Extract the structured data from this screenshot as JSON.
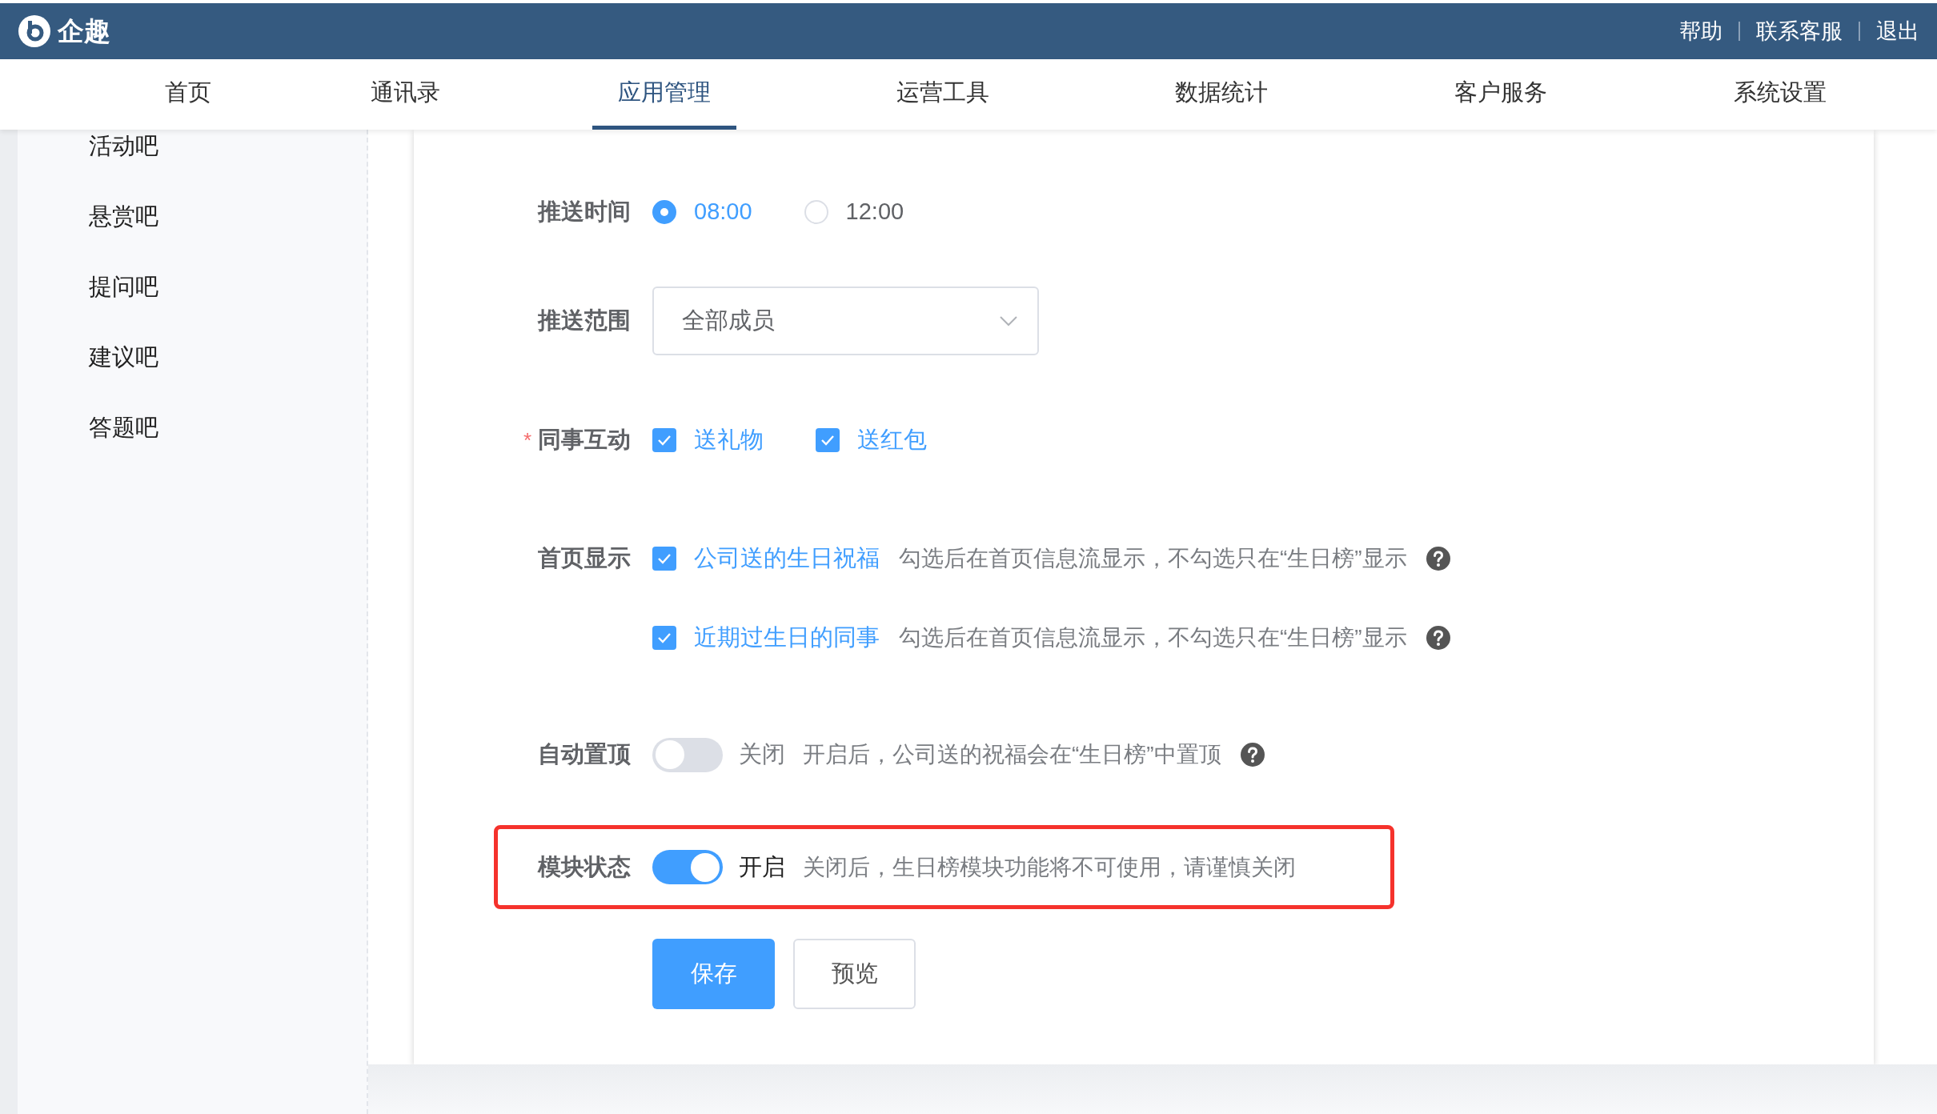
{
  "header": {
    "logo_text": "企趣",
    "links": [
      "帮助",
      "联系客服",
      "退出"
    ]
  },
  "nav": [
    {
      "label": "首页",
      "selected": false
    },
    {
      "label": "通讯录",
      "selected": false
    },
    {
      "label": "应用管理",
      "selected": true
    },
    {
      "label": "运营工具",
      "selected": false
    },
    {
      "label": "数据统计",
      "selected": false
    },
    {
      "label": "客户服务",
      "selected": false
    },
    {
      "label": "系统设置",
      "selected": false
    }
  ],
  "sidebar": {
    "items": [
      "活动吧",
      "悬赏吧",
      "提问吧",
      "建议吧",
      "答题吧"
    ]
  },
  "form": {
    "rows": [
      {
        "kind": "radio",
        "label": "推送时间",
        "options": [
          {
            "label": "08:00",
            "selected": true
          },
          {
            "label": "12:00",
            "selected": false
          }
        ]
      },
      {
        "kind": "select",
        "label": "推送范围",
        "value": "全部成员"
      },
      {
        "kind": "checkboxes",
        "label": "同事互动",
        "required_mark": "*",
        "options": [
          {
            "label": "送礼物",
            "checked": true
          },
          {
            "label": "送红包",
            "checked": true
          }
        ]
      },
      {
        "kind": "checkbox_hints",
        "label": "首页显示",
        "options": [
          {
            "label": "公司送的生日祝福",
            "checked": true,
            "hint": "勾选后在首页信息流显示，不勾选只在“生日榜”显示",
            "help": true
          },
          {
            "label": "近期过生日的同事",
            "checked": true,
            "hint": "勾选后在首页信息流显示，不勾选只在“生日榜”显示",
            "help": true
          }
        ]
      },
      {
        "kind": "toggle",
        "label": "自动置顶",
        "on": false,
        "state_text": "关闭",
        "hint": "开启后，公司送的祝福会在“生日榜”中置顶",
        "help": true,
        "highlighted": false
      },
      {
        "kind": "toggle",
        "label": "模块状态",
        "on": true,
        "state_text": "开启",
        "hint": "关闭后，生日榜模块功能将不可使用，请谨慎关闭",
        "help": false,
        "highlighted": true
      }
    ],
    "buttons": [
      {
        "label": "保存",
        "primary": true
      },
      {
        "label": "预览",
        "primary": false
      }
    ]
  }
}
